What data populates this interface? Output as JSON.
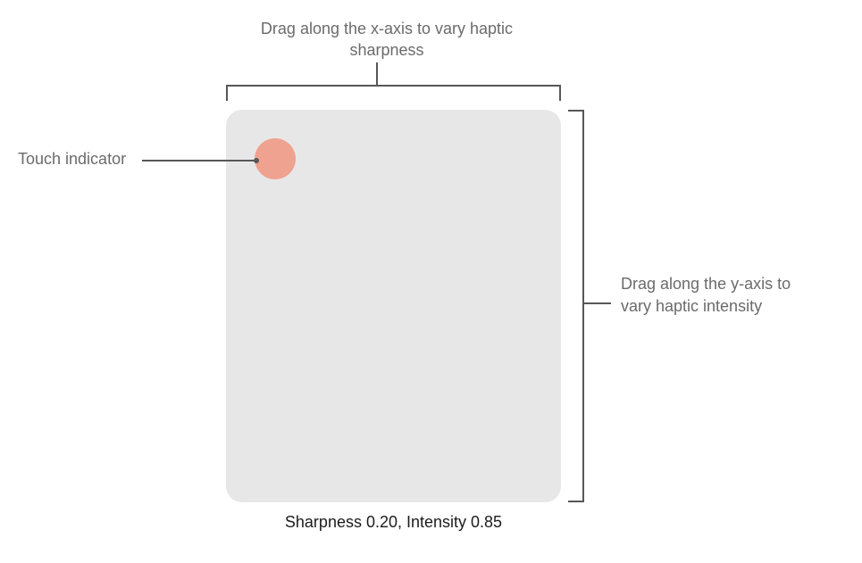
{
  "annotations": {
    "top": "Drag along the x-axis to vary haptic sharpness",
    "left": "Touch indicator",
    "right": "Drag along the y-axis to vary haptic intensity"
  },
  "readout": {
    "sharpness": 0.2,
    "intensity": 0.85,
    "text": "Sharpness 0.20, Intensity 0.85"
  },
  "colors": {
    "panel": "#e7e7e7",
    "touch": "#efa28f",
    "line": "#575757",
    "label": "#6b6b6b",
    "caption": "#1c1c1c"
  }
}
